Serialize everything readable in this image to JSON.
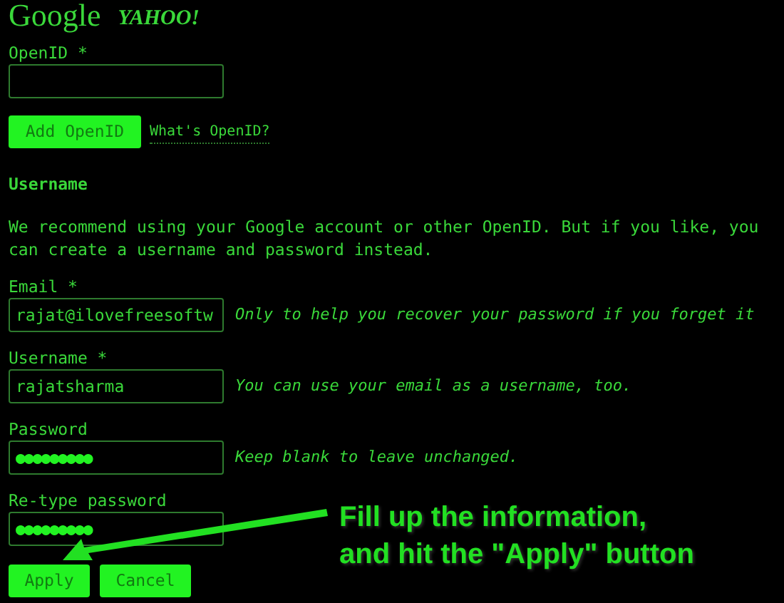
{
  "logos": [
    "Google",
    "YAHOO!"
  ],
  "openid": {
    "label": "OpenID *"
  },
  "add_button": "Add OpenID",
  "help_link": "What's OpenID?",
  "section_heading": "Username",
  "intro": "We recommend using your Google account or other OpenID. But if you like, you can create a username and password instead.",
  "fields": [
    {
      "label": "Email *",
      "value": "rajat@ilovefreesoftw",
      "hint": "Only to help you recover your password if you forget it",
      "kind": "text"
    },
    {
      "label": "Username *",
      "value": "rajatsharma",
      "hint": "You can use your email as a username, too.",
      "kind": "text"
    },
    {
      "label": "Password",
      "value": "●●●●●●●●●",
      "hint": "Keep blank to leave unchanged.",
      "kind": "password"
    },
    {
      "label": "Re-type password",
      "value": "●●●●●●●●●",
      "kind": "password"
    }
  ],
  "buttons": [
    "Apply",
    "Cancel"
  ],
  "callout": [
    "Fill up the information,",
    "and hit the \"Apply\" button"
  ]
}
